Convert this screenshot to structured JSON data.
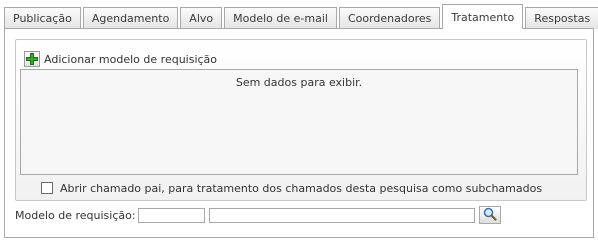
{
  "tabs": [
    {
      "label": "Publicação",
      "active": false
    },
    {
      "label": "Agendamento",
      "active": false
    },
    {
      "label": "Alvo",
      "active": false
    },
    {
      "label": "Modelo de e-mail",
      "active": false
    },
    {
      "label": "Coordenadores",
      "active": false
    },
    {
      "label": "Tratamento",
      "active": true
    },
    {
      "label": "Respostas",
      "active": false
    }
  ],
  "panel": {
    "add_button_label": "Adicionar modelo de requisição",
    "add_icon": "plus-icon",
    "grid_empty_text": "Sem dados para exibir.",
    "checkbox_label": "Abrir chamado pai, para tratamento dos chamados desta pesquisa como subchamados",
    "checkbox_checked": false,
    "field_label": "Modelo de requisição:",
    "code_value": "",
    "description_value": "",
    "search_icon": "magnifier-icon"
  },
  "colors": {
    "plus_green": "#3aa833",
    "border": "#a8a8a8"
  }
}
